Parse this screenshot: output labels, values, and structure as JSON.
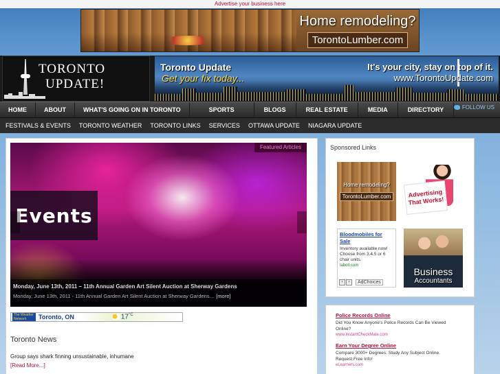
{
  "top_ad": {
    "link_text": "Advertise your business here",
    "banner_line1": "Home remodeling?",
    "banner_line2": "TorontoLumber.com"
  },
  "header": {
    "logo_line1": "TORONTO",
    "logo_line2": "UPDATE!",
    "banner_title": "Toronto Update",
    "banner_subtitle": "Get your fix today...",
    "banner_tagline": "It's your city, stay on top of it.",
    "banner_url": "www.TorontoUpdate.com"
  },
  "nav_primary": {
    "items": [
      "HOME",
      "ABOUT",
      "WHAT'S GOING ON IN TORONTO",
      "SPORTS",
      "BLOGS",
      "REAL ESTATE",
      "MEDIA",
      "DIRECTORY"
    ],
    "follow_label": "FOLLOW US"
  },
  "nav_secondary": {
    "items": [
      "FESTIVALS & EVENTS",
      "TORONTO WEATHER",
      "TORONTO LINKS",
      "SERVICES",
      "OTTAWA UPDATE",
      "NIAGARA UPDATE"
    ]
  },
  "slider": {
    "tag": "Featured Articles",
    "overlay_label": "Events",
    "caption_title": "Monday, June 13th, 2011 – 11th Annual Garden Art Silent Auction at Sherway Gardens",
    "caption_desc": "Monday, June 13th, 2011 - 11th Annual Garden Art Silent Auction at Sherway Gardens…",
    "more_label": "[more]"
  },
  "weather": {
    "logo_text": "The Weather Network",
    "city": "Toronto, ON",
    "temp": "17",
    "unit": "°C"
  },
  "news": {
    "section_title": "Toronto News",
    "headline": "Group says shark finning unsustainable, inhumane",
    "read_more": "[Read More...]"
  },
  "sponsored": {
    "title": "Sponsored Links",
    "lumber_line1": "Home remodeling?",
    "lumber_line2": "TorontoLumber.com",
    "adv_text": "Advertising That Works!",
    "blood_title": "Bloodmobiles for Sale",
    "blood_desc": "Inventory available now! Choose from 3.4.5 or 6 chair units.",
    "blood_url": "labolt.com",
    "adchoices": "AdChoices",
    "biz_line1": "Business",
    "biz_line2": "Accountants"
  },
  "text_ads": [
    {
      "title": "Police Records Online",
      "desc": "Did You Know Anyone's Police Records Can Be Viewed Online?",
      "url": "www.InstantCheckMate.com"
    },
    {
      "title": "Earn Your Degree Online",
      "desc": "Compare 3000+ Degrees. Study Any Subject Online. Request Free Info!",
      "url": "eLearners.com"
    }
  ],
  "colors": {
    "accent": "#b5123a",
    "nav_bg": "#2c2c2c",
    "follow": "#8fc4f0"
  }
}
